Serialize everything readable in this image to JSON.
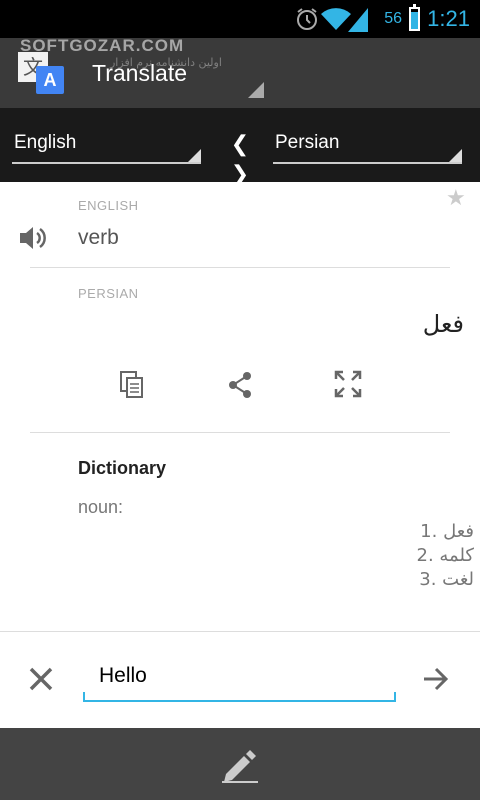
{
  "status_bar": {
    "time": "1:21",
    "battery": "56"
  },
  "action_bar": {
    "title": "Translate",
    "logo_back_glyph": "文",
    "logo_front_glyph": "A",
    "watermark": "SOFTGOZAR.COM",
    "watermark_sub": "اولین دانشنامه نرم افزار"
  },
  "languages": {
    "source": "English",
    "target": "Persian",
    "swap_label": "❮ ❯"
  },
  "result": {
    "source_label": "ENGLISH",
    "source_text": "verb",
    "target_label": "PERSIAN",
    "target_text": "فعل"
  },
  "dictionary": {
    "title": "Dictionary",
    "part_of_speech": "noun:",
    "entries": [
      "1. فعل",
      "2. کلمه",
      "3. لغت"
    ]
  },
  "input": {
    "value": "Hello"
  },
  "icons": {
    "speaker": "speaker-icon",
    "star": "star-icon",
    "copy": "copy-icon",
    "share": "share-icon",
    "fullscreen": "fullscreen-icon",
    "clear": "close-icon",
    "submit": "arrow-right-icon",
    "edit": "pencil-icon"
  },
  "colors": {
    "accent": "#33b5e5",
    "action_bar": "#3a3a3a",
    "lang_bar": "#1a1a1a",
    "bottom_bar": "#444444",
    "logo": "#4285f4"
  }
}
